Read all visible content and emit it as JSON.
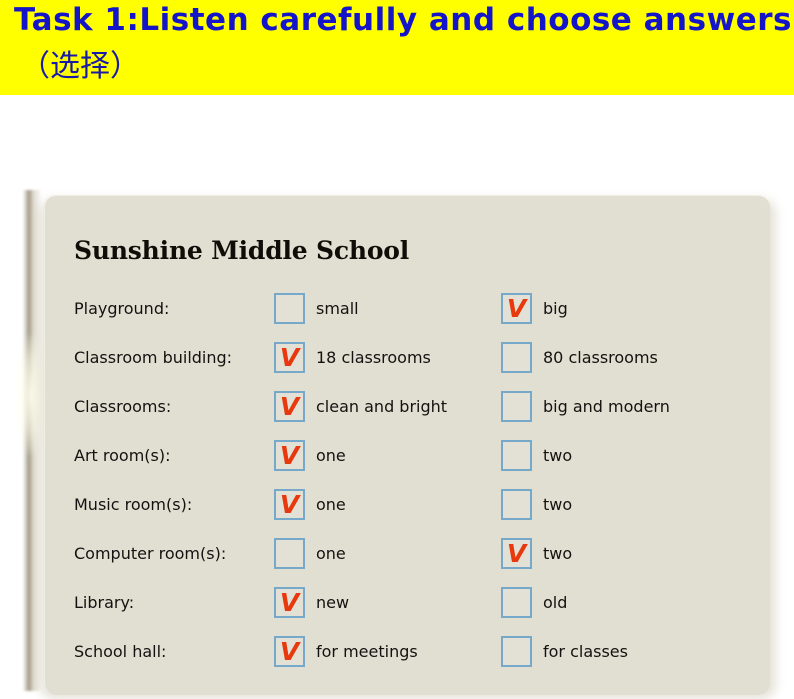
{
  "header": {
    "title": "Task 1:Listen  carefully and choose answers.",
    "subtitle": "（选择）",
    "background_color": "#ffff00",
    "text_color": "#1414c8"
  },
  "card": {
    "title": "Sunshine Middle School",
    "background_color": "#e1dfd2",
    "checkbox_border_color": "#76a9c9",
    "check_color": "#e8380d",
    "check_glyph": "V",
    "rows": [
      {
        "label": "Playground:",
        "option_a": {
          "text": "small",
          "checked": false
        },
        "option_b": {
          "text": "big",
          "checked": true
        }
      },
      {
        "label": "Classroom building:",
        "option_a": {
          "text": "18 classrooms",
          "checked": true
        },
        "option_b": {
          "text": "80 classrooms",
          "checked": false
        }
      },
      {
        "label": "Classrooms:",
        "option_a": {
          "text": "clean and bright",
          "checked": true
        },
        "option_b": {
          "text": "big and modern",
          "checked": false
        }
      },
      {
        "label": "Art room(s):",
        "option_a": {
          "text": "one",
          "checked": true
        },
        "option_b": {
          "text": "two",
          "checked": false
        }
      },
      {
        "label": "Music room(s):",
        "option_a": {
          "text": "one",
          "checked": true
        },
        "option_b": {
          "text": "two",
          "checked": false
        }
      },
      {
        "label": "Computer room(s):",
        "option_a": {
          "text": "one",
          "checked": false
        },
        "option_b": {
          "text": "two",
          "checked": true
        }
      },
      {
        "label": "Library:",
        "option_a": {
          "text": "new",
          "checked": true
        },
        "option_b": {
          "text": "old",
          "checked": false
        }
      },
      {
        "label": "School hall:",
        "option_a": {
          "text": "for meetings",
          "checked": true
        },
        "option_b": {
          "text": "for classes",
          "checked": false
        }
      }
    ]
  }
}
